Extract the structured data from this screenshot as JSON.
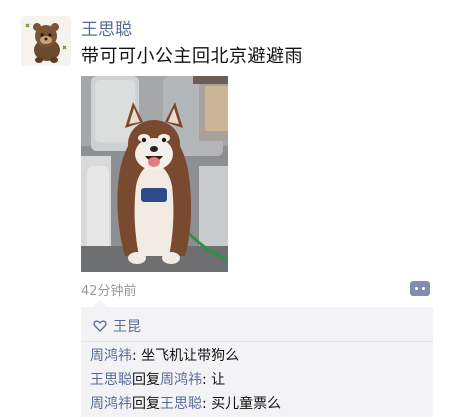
{
  "post": {
    "author": "王思聪",
    "text": "带可可小公主回北京避避雨",
    "timestamp": "42分钟前",
    "image_subject": "dog-in-airplane-seat"
  },
  "interactions": {
    "like_icon": "heart-outline-icon",
    "likes": "王昆",
    "comments": [
      {
        "author": "周鸿祎",
        "reply_word": "",
        "reply_to": "",
        "separator": ": ",
        "text": "坐飞机让带狗么"
      },
      {
        "author": "王思聪",
        "reply_word": "回复",
        "reply_to": "周鸿祎",
        "separator": ": ",
        "text": "让"
      },
      {
        "author": "周鸿祎",
        "reply_word": "回复",
        "reply_to": "王思聪",
        "separator": ": ",
        "text": "买儿童票么"
      }
    ]
  },
  "colors": {
    "link": "#576b95",
    "panel_bg": "#f3f3f5",
    "timestamp": "#9a9a9a"
  }
}
